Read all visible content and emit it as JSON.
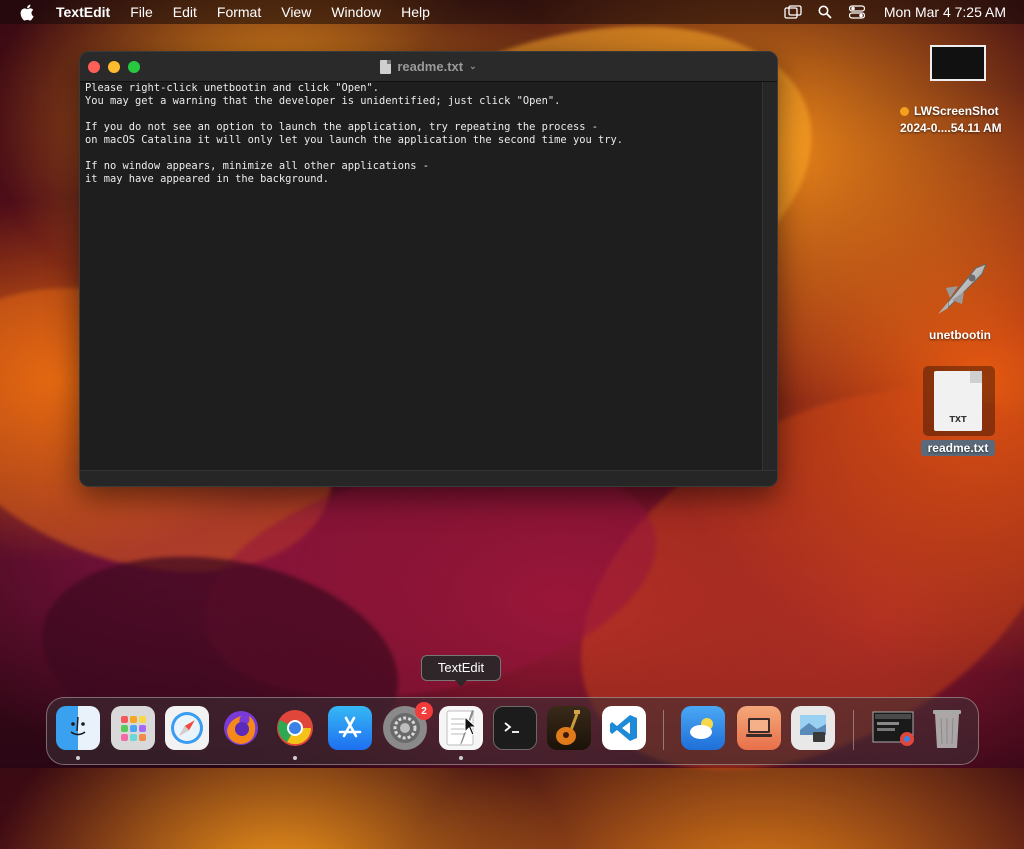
{
  "menubar": {
    "app_name": "TextEdit",
    "items": [
      "File",
      "Edit",
      "Format",
      "View",
      "Window",
      "Help"
    ],
    "clock": "Mon Mar 4  7:25 AM"
  },
  "window": {
    "title": "readme.txt",
    "lines": [
      "Please right-click unetbootin and click \"Open\".",
      "You may get a warning that the developer is unidentified; just click \"Open\".",
      "",
      "If you do not see an option to launch the application, try repeating the process -",
      "on macOS Catalina it will only let you launch the application the second time you try.",
      "",
      "If no window appears, minimize all other applications -",
      "it may have appeared in the background."
    ]
  },
  "desktop": {
    "screenshot_name": "LWScreenShot",
    "screenshot_date": "2024-0....54.11 AM",
    "unetbootin_label": "unetbootin",
    "readme_label": "readme.txt",
    "readme_file_type": "TXT"
  },
  "tooltip": "TextEdit",
  "dock": {
    "badge_count": "2",
    "apps": [
      "Finder",
      "Launchpad",
      "Safari",
      "Firefox",
      "Chrome",
      "App Store",
      "System Settings",
      "TextEdit",
      "Terminal",
      "GarageBand",
      "Visual Studio Code",
      "Weather",
      "Screen Sharing",
      "Preview",
      "Screenshot",
      "Trash"
    ]
  }
}
